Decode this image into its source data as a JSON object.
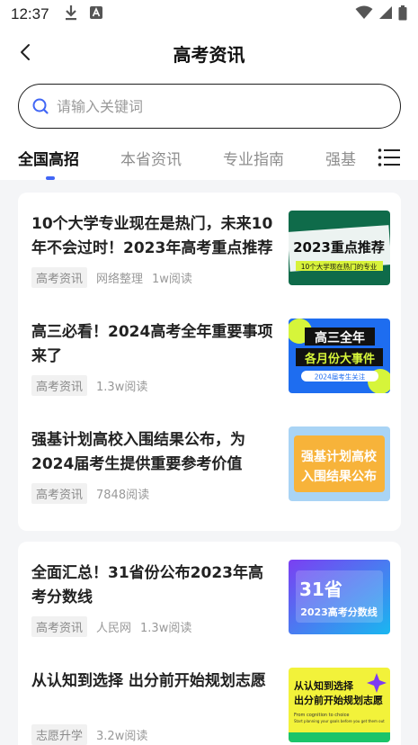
{
  "status_bar": {
    "time": "12:37"
  },
  "header": {
    "title": "高考资讯"
  },
  "search": {
    "placeholder": "请输入关键词"
  },
  "tabs": [
    {
      "label": "全国高招",
      "active": true
    },
    {
      "label": "本省资讯",
      "active": false
    },
    {
      "label": "专业指南",
      "active": false
    },
    {
      "label": "强基",
      "active": false
    }
  ],
  "cards": [
    {
      "articles": [
        {
          "title": "10个大学专业现在是热门，未来10年不会过时！2023年高考重点推荐",
          "tag": "高考资讯",
          "source": "网络整理",
          "reads": "1w阅读",
          "thumb": {
            "line1": "2023重点推荐",
            "line2": "10个大学现在热门的专业"
          }
        },
        {
          "title": "高三必看！2024高考全年重要事项来了",
          "tag": "高考资讯",
          "source": "",
          "reads": "1.3w阅读",
          "thumb": {
            "line1": "高三全年",
            "line2": "各月份大事件",
            "line3": "2024届考生关注"
          }
        },
        {
          "title": "强基计划高校入围结果公布，为2024届考生提供重要参考价值",
          "tag": "高考资讯",
          "source": "",
          "reads": "7848阅读",
          "thumb": {
            "line1": "强基计划高校",
            "line2": "入围结果公布"
          }
        }
      ]
    },
    {
      "articles": [
        {
          "title": "全面汇总！31省份公布2023年高考分数线",
          "tag": "高考资讯",
          "source": "人民网",
          "reads": "1.3w阅读",
          "thumb": {
            "line1": "31省",
            "line2": "2023高考分数线"
          }
        },
        {
          "title": "从认知到选择 出分前开始规划志愿",
          "tag": "志愿升学",
          "source": "",
          "reads": "3.2w阅读",
          "thumb": {
            "line1": "从认知到选择",
            "line2": "出分前开始规划志愿",
            "line3": "From cognition to choice",
            "line4": "Start planning your goals before you get them out"
          }
        }
      ]
    }
  ],
  "colors": {
    "accent": "#4166f5",
    "background": "#f4f5f7"
  }
}
